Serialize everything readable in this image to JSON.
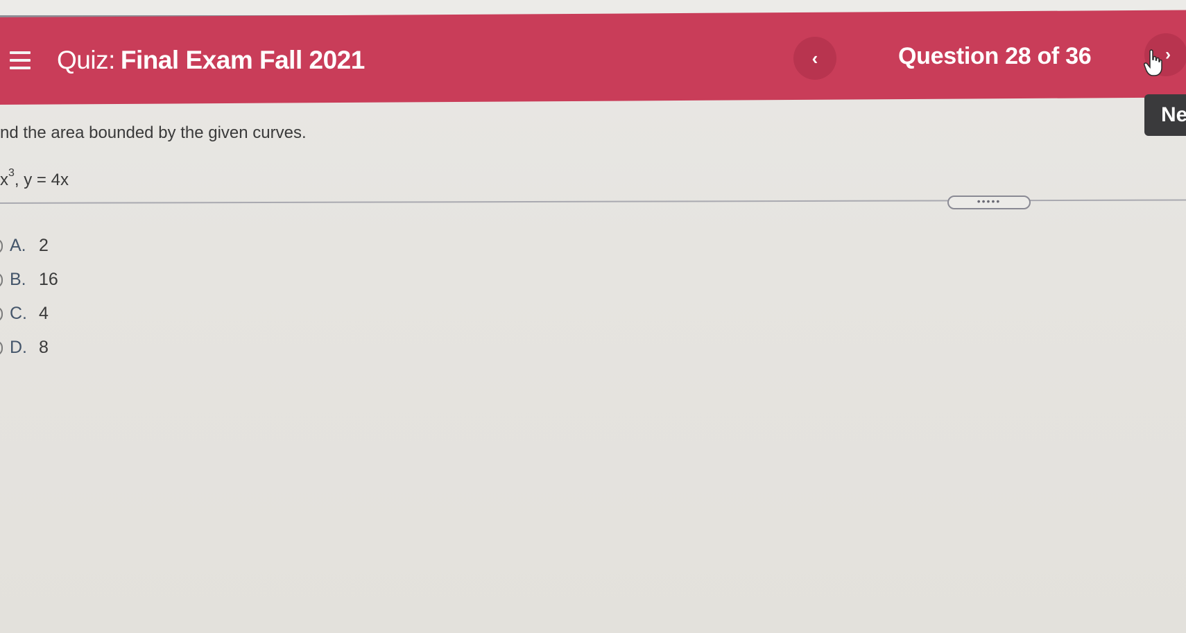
{
  "header": {
    "quiz_prefix": "Quiz:",
    "quiz_name": "Final Exam Fall 2021",
    "question_counter": "Question 28 of 36",
    "prev_symbol": "‹",
    "next_symbol": "›",
    "next_tooltip": "Ne"
  },
  "question": {
    "prompt": "nd the area bounded by the given curves.",
    "equation_left": "x",
    "equation_exponent": "3",
    "equation_right": ", y = 4x"
  },
  "divider_handle": "•••••",
  "options": [
    {
      "letter": "A.",
      "value": "2"
    },
    {
      "letter": "B.",
      "value": "16"
    },
    {
      "letter": "C.",
      "value": "4"
    },
    {
      "letter": "D.",
      "value": "8"
    }
  ],
  "colors": {
    "header_bg": "#c93d59",
    "nav_button": "#b8344f",
    "tooltip_bg": "#3a3a3c"
  }
}
